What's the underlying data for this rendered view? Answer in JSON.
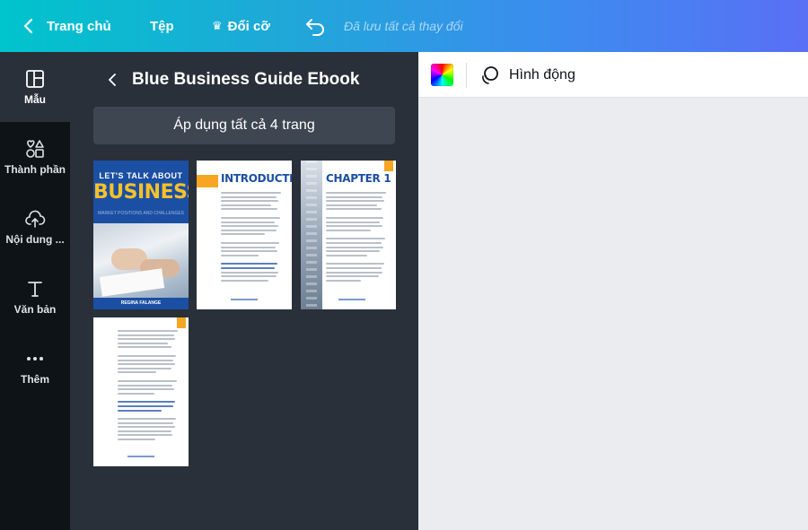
{
  "topbar": {
    "home_label": "Trang chủ",
    "file_label": "Tệp",
    "resize_label": "Đổi cỡ",
    "saved_status": "Đã lưu tất cả thay đổi",
    "gradient_start": "#00c4cc",
    "gradient_end": "#5a6ff5"
  },
  "rail": {
    "items": [
      {
        "label": "Mẫu",
        "icon": "template-icon",
        "active": true
      },
      {
        "label": "Thành phần",
        "icon": "elements-icon",
        "active": false
      },
      {
        "label": "Nội dung ...",
        "icon": "upload-icon",
        "active": false
      },
      {
        "label": "Văn bản",
        "icon": "text-icon",
        "active": false
      },
      {
        "label": "Thêm",
        "icon": "more-icon",
        "active": false
      }
    ]
  },
  "panel": {
    "title": "Blue Business Guide Ebook",
    "apply_label": "Áp dụng tất cả 4 trang",
    "pages": [
      {
        "kind": "cover",
        "top_text": "LET'S TALK ABOUT",
        "big_text": "BUSINESS",
        "sub_text": "MARKET POSITIONS AND CHALLENGES",
        "author": "REGINA FALANGE"
      },
      {
        "kind": "text",
        "heading": "INTRODUCTION"
      },
      {
        "kind": "text",
        "heading": "CHAPTER 1"
      },
      {
        "kind": "text",
        "heading": ""
      }
    ]
  },
  "editor": {
    "animate_label": "Hình động"
  },
  "colors": {
    "rail_bg": "#0e1318",
    "panel_bg": "#293039",
    "brand_blue": "#1b4fa3",
    "accent_orange": "#f6a623",
    "accent_yellow": "#f6c129"
  }
}
